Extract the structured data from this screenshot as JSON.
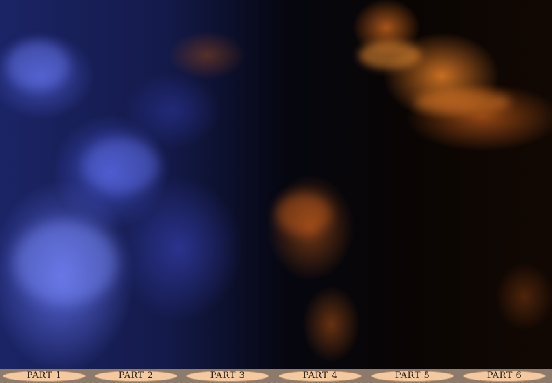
{
  "tabs": [
    {
      "label": "PART 1"
    },
    {
      "label": "PART 2"
    },
    {
      "label": "PART 3"
    },
    {
      "label": "PART 4"
    },
    {
      "label": "PART 5"
    },
    {
      "label": "PART 6"
    }
  ],
  "colors": {
    "tab_fill": "#f4c9a0",
    "tab_bar": "#8c7a6a",
    "accent_blue": "#5f6ee6",
    "accent_orange": "#e88028"
  }
}
